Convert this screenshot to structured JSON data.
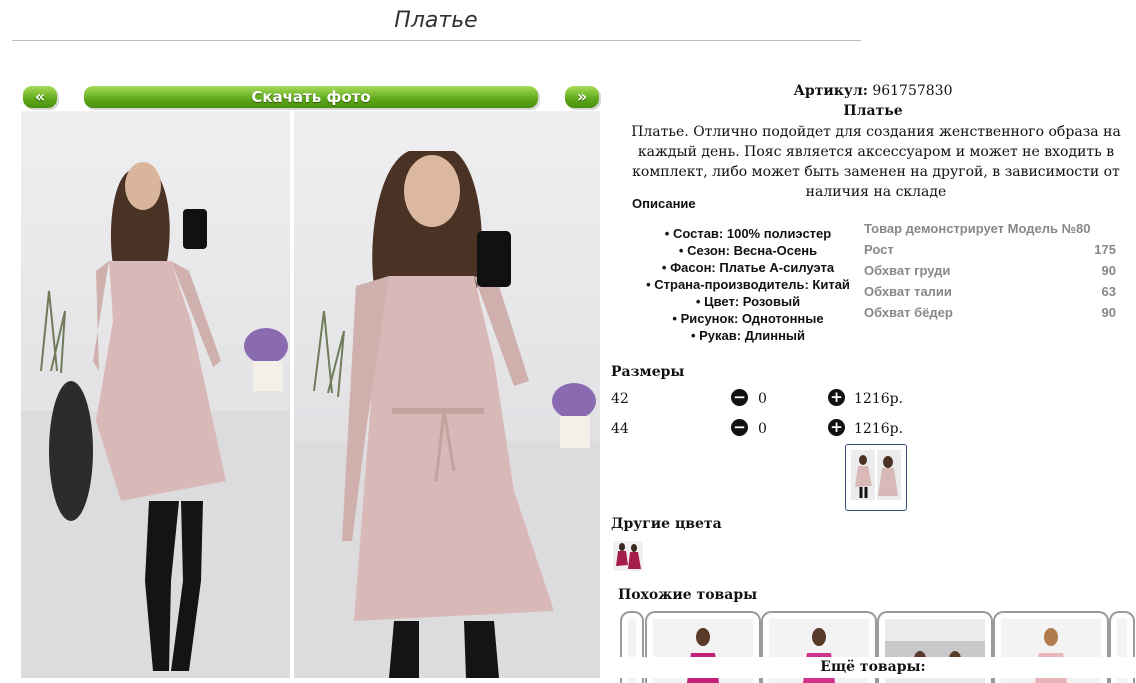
{
  "page": {
    "title": "Платье"
  },
  "gallery": {
    "prev_label": "«",
    "download_label": "Скачать фото",
    "next_label": "»"
  },
  "product": {
    "article_label": "Артикул:",
    "article_value": "961757830",
    "name": "Платье",
    "description": "Платье. Отлично подойдет для создания женственного образа на каждый день. Пояс является аксессуаром и может не входить в комплект, либо может быть заменен на другой, в зависимости от наличия на складе"
  },
  "specs": {
    "heading": "Описание",
    "items": [
      "Состав: 100% полиэстер",
      "Сезон: Весна-Осень",
      "Фасон: Платье А-силуэта",
      "Страна-производитель: Китай",
      "Цвет: Розовый",
      "Рисунок: Однотонные",
      "Рукав: Длинный"
    ]
  },
  "model": {
    "rows": [
      {
        "label": "Товар демонстрирует Модель №80",
        "value": ""
      },
      {
        "label": "Рост",
        "value": "175"
      },
      {
        "label": "Обхват груди",
        "value": "90"
      },
      {
        "label": "Обхват талии",
        "value": "63"
      },
      {
        "label": "Обхват бёдер",
        "value": "90"
      }
    ]
  },
  "sizes": {
    "heading": "Размеры",
    "rows": [
      {
        "size": "42",
        "qty": "0",
        "price": "1216р."
      },
      {
        "size": "44",
        "qty": "0",
        "price": "1216р."
      }
    ],
    "minus_icon": "minus-circle-icon",
    "plus_icon": "plus-circle-icon"
  },
  "other_colors": {
    "heading": "Другие цвета"
  },
  "similar": {
    "heading": "Похожие товары",
    "more_label": "Ещё товары:"
  },
  "colors": {
    "button_green": "#5ea81a",
    "dress_pink": "#d8b9b7",
    "text": "#111111",
    "muted_text": "#888888"
  }
}
